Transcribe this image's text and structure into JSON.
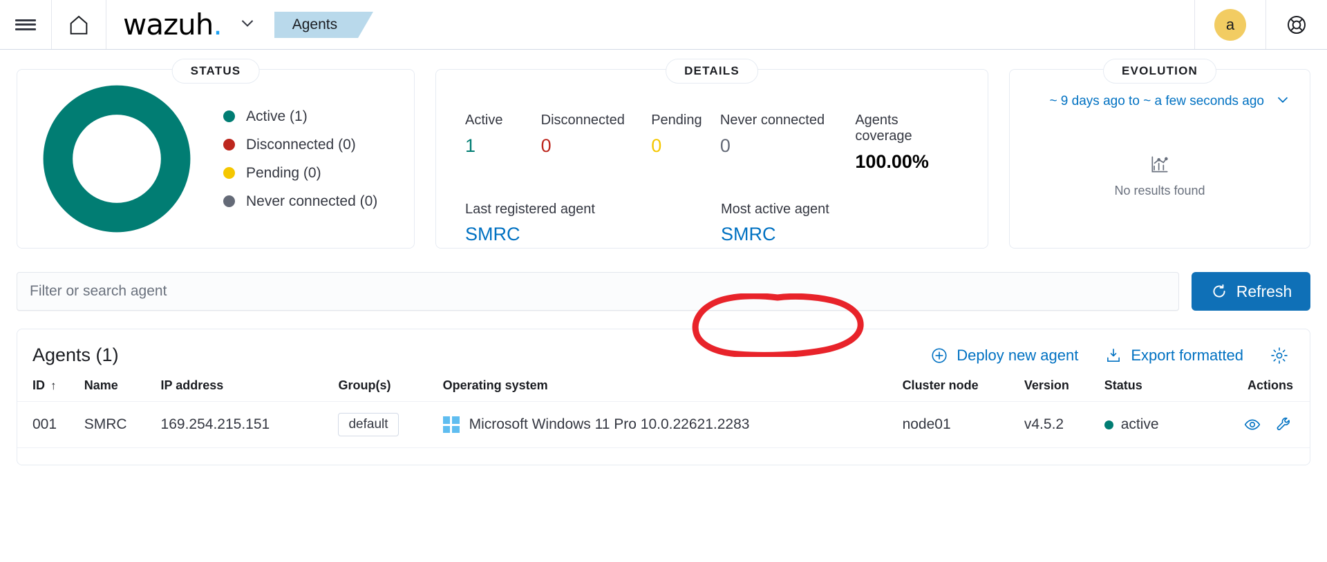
{
  "header": {
    "menu_icon": "hamburger-icon",
    "home_icon": "home-icon",
    "logo_text": "wazuh",
    "logo_dot": ".",
    "logo_chevron_icon": "chevron-down-icon",
    "breadcrumb": "Agents",
    "avatar_initial": "a",
    "help_icon": "help-lifebuoy-icon"
  },
  "status_panel": {
    "title": "STATUS",
    "legend": [
      {
        "label": "Active (1)",
        "color": "#017d73"
      },
      {
        "label": "Disconnected (0)",
        "color": "#bd271e"
      },
      {
        "label": "Pending (0)",
        "color": "#f5c700"
      },
      {
        "label": "Never connected (0)",
        "color": "#646a77"
      }
    ]
  },
  "details_panel": {
    "title": "DETAILS",
    "metrics": [
      {
        "label": "Active",
        "value": "1",
        "color": "#017d73"
      },
      {
        "label": "Disconnected",
        "value": "0",
        "color": "#bd271e"
      },
      {
        "label": "Pending",
        "value": "0",
        "color": "#f5c700"
      },
      {
        "label": "Never connected",
        "value": "0",
        "color": "#646a77"
      },
      {
        "label": "Agents coverage",
        "value": "100.00%",
        "color": "#000000"
      }
    ],
    "last_registered_label": "Last registered agent",
    "last_registered_value": "SMRC",
    "most_active_label": "Most active agent",
    "most_active_value": "SMRC"
  },
  "evolution_panel": {
    "title": "EVOLUTION",
    "time_range": "~ 9 days ago to ~ a few seconds ago",
    "range_chevron_icon": "chevron-down-icon",
    "empty_icon": "chart-icon",
    "empty_text": "No results found"
  },
  "search": {
    "placeholder": "Filter or search agent",
    "value": "",
    "refresh_label": "Refresh",
    "refresh_icon": "refresh-icon"
  },
  "agents_table": {
    "title": "Agents (1)",
    "deploy_label": "Deploy new agent",
    "deploy_icon": "plus-in-circle-icon",
    "export_label": "Export formatted",
    "export_icon": "export-icon",
    "settings_icon": "gear-icon",
    "columns": [
      "ID",
      "Name",
      "IP address",
      "Group(s)",
      "Operating system",
      "Cluster node",
      "Version",
      "Status",
      "Actions"
    ],
    "sort_column": "ID",
    "sort_arrow": "↑",
    "rows": [
      {
        "id": "001",
        "name": "SMRC",
        "ip": "169.254.215.151",
        "group": "default",
        "os_icon": "windows-icon",
        "os": "Microsoft Windows 11 Pro 10.0.22621.2283",
        "cluster_node": "node01",
        "version": "v4.5.2",
        "status": "active",
        "status_color": "#017d73",
        "action_icons": [
          "eye-icon",
          "wrench-icon"
        ]
      }
    ]
  },
  "annotation": {
    "shape": "hand-drawn-ellipse",
    "color": "#e8232a",
    "target": "Deploy new agent"
  },
  "colors": {
    "teal": "#017d73",
    "red": "#bd271e",
    "yellow": "#f5c700",
    "gray": "#646a77",
    "link_blue": "#0071c2",
    "primary_blue": "#0f70b7",
    "breadcrumb_blue": "#b9d9eb",
    "avatar_yellow": "#f2cc62",
    "windows_blue": "#5fbdf0"
  }
}
